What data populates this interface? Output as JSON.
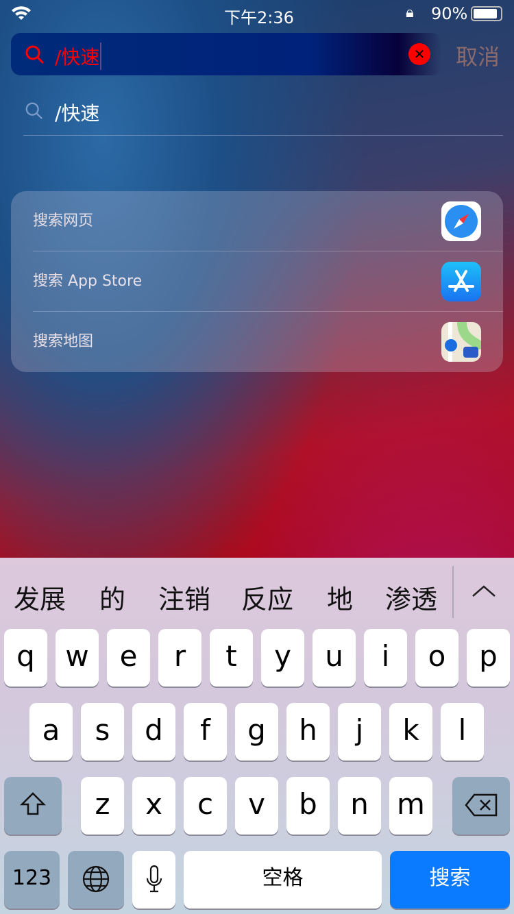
{
  "status": {
    "time": "下午2:36",
    "battery": "90%",
    "battery_level": 90
  },
  "search": {
    "query": "/快速",
    "cancel": "取消"
  },
  "suggestion": {
    "text": "/快速"
  },
  "actions": [
    {
      "label": "搜索网页",
      "icon": "safari-icon"
    },
    {
      "label": "搜索 App Store",
      "icon": "app-store-icon"
    },
    {
      "label": "搜索地图",
      "icon": "maps-icon"
    }
  ],
  "keyboard": {
    "candidates": [
      "发展",
      "的",
      "注销",
      "反应",
      "地",
      "渗透"
    ],
    "row1": [
      "q",
      "w",
      "e",
      "r",
      "t",
      "y",
      "u",
      "i",
      "o",
      "p"
    ],
    "row2": [
      "a",
      "s",
      "d",
      "f",
      "g",
      "h",
      "j",
      "k",
      "l"
    ],
    "row3": [
      "z",
      "x",
      "c",
      "v",
      "b",
      "n",
      "m"
    ],
    "numbers": "123",
    "space": "空格",
    "search": "搜索"
  },
  "colors": {
    "accent": "#0a7aff",
    "query": "#ff0000"
  }
}
